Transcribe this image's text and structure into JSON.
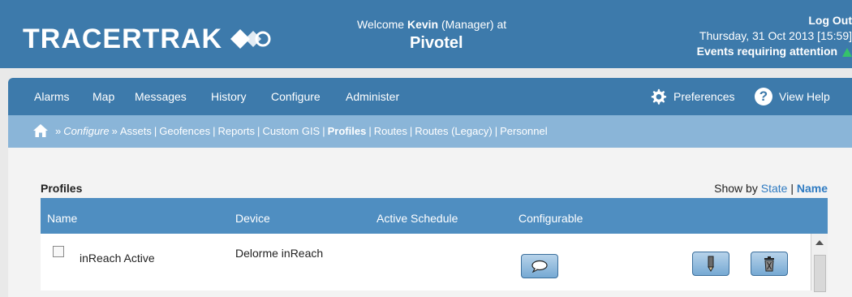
{
  "header": {
    "logo_text": "TRACERTRAK",
    "welcome_prefix": "Welcome ",
    "user_name": "Kevin",
    "user_role_suffix": " (Manager) at",
    "company": "Pivotel",
    "logout": "Log Out",
    "datetime": "Thursday, 31 Oct 2013 [15:59]",
    "events": "Events requiring attention"
  },
  "nav": {
    "items": [
      "Alarms",
      "Map",
      "Messages",
      "History",
      "Configure",
      "Administer"
    ],
    "preferences": "Preferences",
    "help": "View Help",
    "help_glyph": "?"
  },
  "breadcrumb": {
    "sep": "»",
    "configure": "Configure",
    "links": [
      "Assets",
      "Geofences",
      "Reports",
      "Custom GIS",
      "Profiles",
      "Routes",
      "Routes (Legacy)",
      "Personnel"
    ],
    "divider": "|"
  },
  "profiles": {
    "title": "Profiles",
    "show_by_label": "Show by ",
    "show_by_state": "State",
    "show_by_divider": " | ",
    "show_by_name": "Name",
    "columns": [
      "Name",
      "Device",
      "Active Schedule",
      "Configurable"
    ],
    "rows": [
      {
        "name": "inReach Active",
        "device": "Delorme inReach",
        "active_schedule": "",
        "configurable": ""
      }
    ]
  },
  "colors": {
    "header_bg": "#3d7aab",
    "breadcrumb_bg": "#8ab5d8",
    "grid_head_bg": "#4f8ec1",
    "link": "#2f7bc2",
    "alert": "#35c26b"
  }
}
